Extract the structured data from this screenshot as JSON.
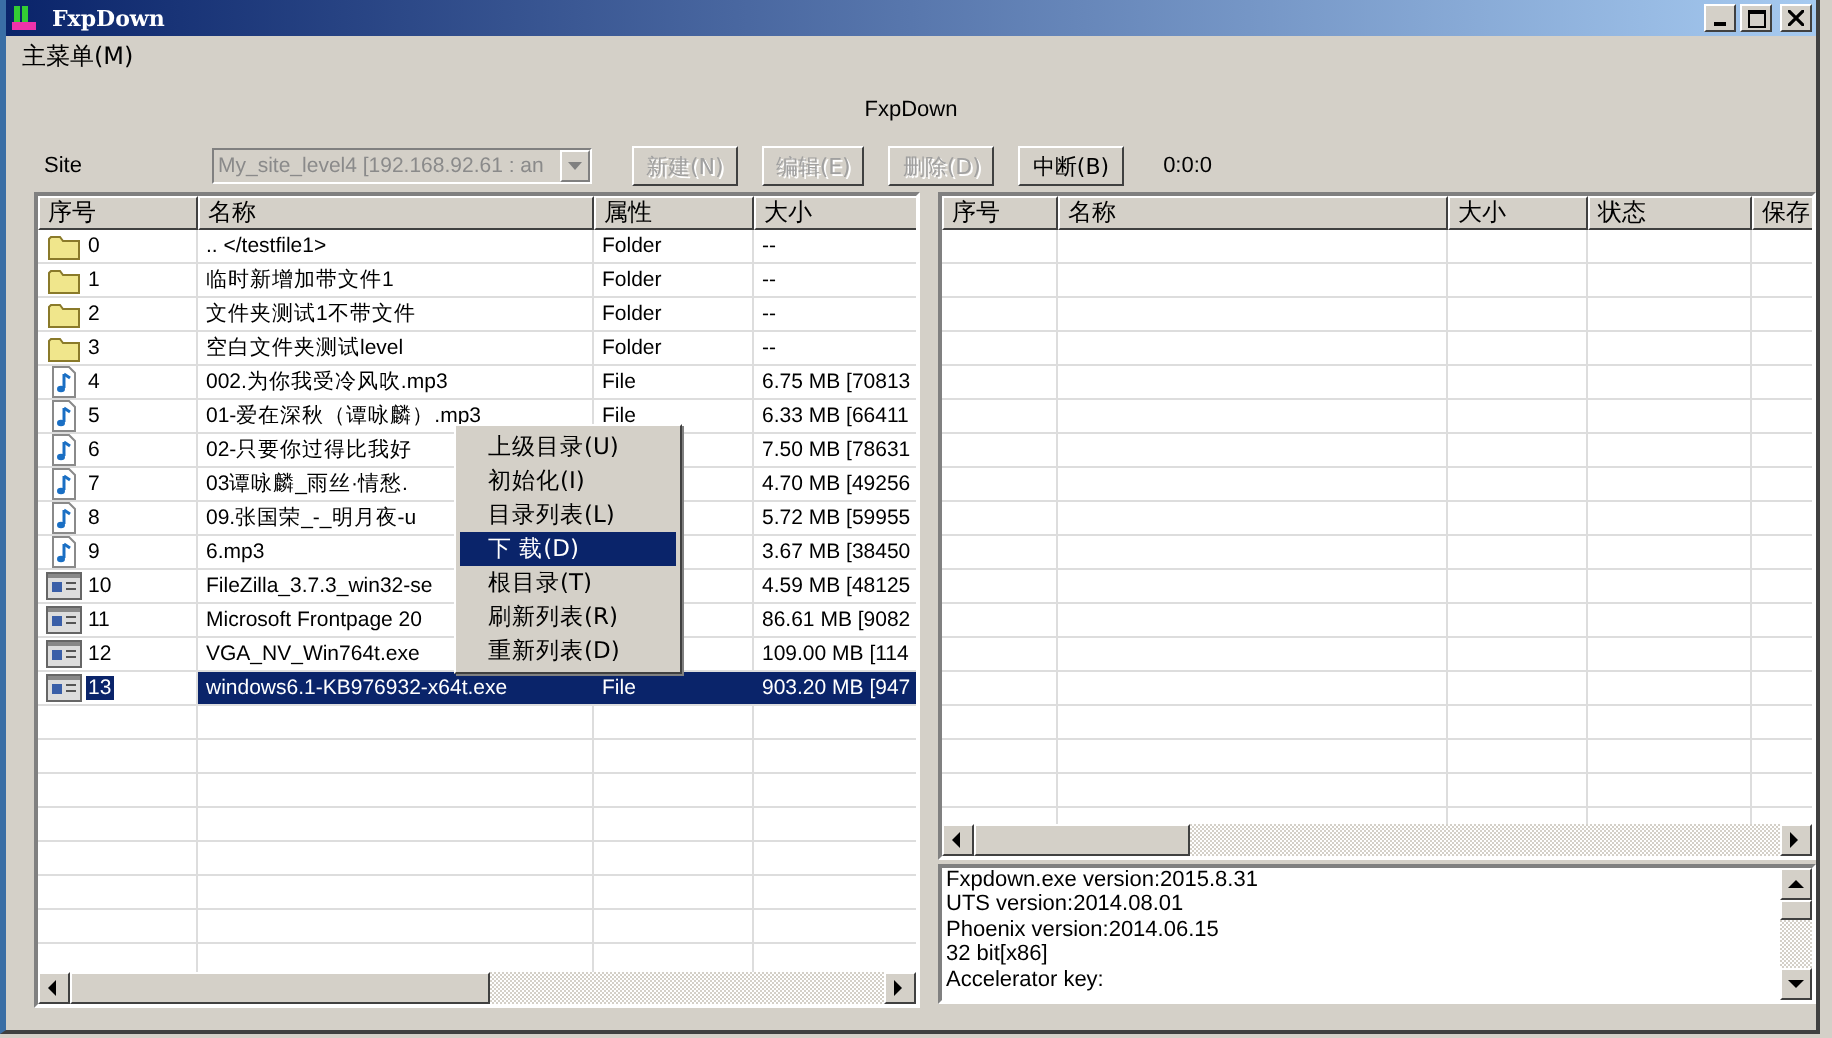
{
  "window": {
    "title": "FxpDown"
  },
  "menu": [
    "主菜单(M)"
  ],
  "header": "FxpDown",
  "toolbar": {
    "site_label": "Site",
    "site_combo": {
      "value": "My_site_level4 [192.168.92.61 : an",
      "disabled": true
    },
    "buttons": [
      {
        "label": "新建(N)",
        "disabled": true
      },
      {
        "label": "编辑(E)",
        "disabled": true
      },
      {
        "label": "删除(D)",
        "disabled": true
      },
      {
        "label": "中断(B)",
        "disabled": false
      }
    ],
    "timer": "0:0:0"
  },
  "left_table": {
    "columns": [
      "序号",
      "名称",
      "属性",
      "大小"
    ],
    "rows": [
      {
        "kind": "folder",
        "index": "0",
        "name": ".. </testfile1>",
        "attr": "Folder",
        "size": "--",
        "selected": false
      },
      {
        "kind": "folder",
        "index": "1",
        "name": "临时新增加带文件1",
        "attr": "Folder",
        "size": "--",
        "selected": false
      },
      {
        "kind": "folder",
        "index": "2",
        "name": "文件夹测试1不带文件",
        "attr": "Folder",
        "size": "--",
        "selected": false
      },
      {
        "kind": "folder",
        "index": "3",
        "name": "空白文件夹测试level",
        "attr": "Folder",
        "size": "--",
        "selected": false
      },
      {
        "kind": "audio",
        "index": "4",
        "name": "002.为你我受冷风吹.mp3",
        "attr": "File",
        "size": "6.75 MB [70813",
        "selected": false
      },
      {
        "kind": "audio",
        "index": "5",
        "name": "01-爱在深秋（谭咏麟）.mp3",
        "attr": "File",
        "size": "6.33 MB [66411",
        "selected": false
      },
      {
        "kind": "audio",
        "index": "6",
        "name": "02-只要你过得比我好",
        "size": "7.50 MB [78631",
        "selected": false
      },
      {
        "kind": "audio",
        "index": "7",
        "name": "03谭咏麟_雨丝·情愁.",
        "size": "4.70 MB [49256",
        "selected": false
      },
      {
        "kind": "audio",
        "index": "8",
        "name": "09.张国荣_-_明月夜-u",
        "size": "5.72 MB [59955",
        "selected": false
      },
      {
        "kind": "audio",
        "index": "9",
        "name": "6.mp3",
        "size": "3.67 MB [38450",
        "selected": false
      },
      {
        "kind": "program",
        "index": "10",
        "name": "FileZilla_3.7.3_win32-se",
        "size": "4.59 MB [48125",
        "selected": false
      },
      {
        "kind": "program",
        "index": "11",
        "name": "Microsoft Frontpage 20",
        "size": "86.61 MB [9082",
        "selected": false
      },
      {
        "kind": "program",
        "index": "12",
        "name": "VGA_NV_Win764t.exe",
        "size": "109.00 MB [114",
        "selected": false
      },
      {
        "kind": "program",
        "index": "13",
        "name": "windows6.1-KB976932-x64t.exe",
        "attr": "File",
        "size": "903.20 MB [947",
        "selected": true
      }
    ]
  },
  "context_menu": {
    "items": [
      {
        "label": "上级目录(U)",
        "selected": false
      },
      {
        "label": "初始化(I)",
        "selected": false
      },
      {
        "label": "目录列表(L)",
        "selected": false
      },
      {
        "label": "下 载(D)",
        "selected": true
      },
      {
        "label": "根目录(T)",
        "selected": false
      },
      {
        "label": "刷新列表(R)",
        "selected": false
      },
      {
        "label": "重新列表(D)",
        "selected": false
      }
    ]
  },
  "right_table": {
    "columns": [
      "序号",
      "名称",
      "大小",
      "状态",
      "保存"
    ]
  },
  "log": {
    "lines": [
      "Fxpdown.exe version:2015.8.31",
      "UTS version:2014.08.01",
      "Phoenix version:2014.06.15",
      "32 bit[x86]",
      "Accelerator key:"
    ]
  }
}
